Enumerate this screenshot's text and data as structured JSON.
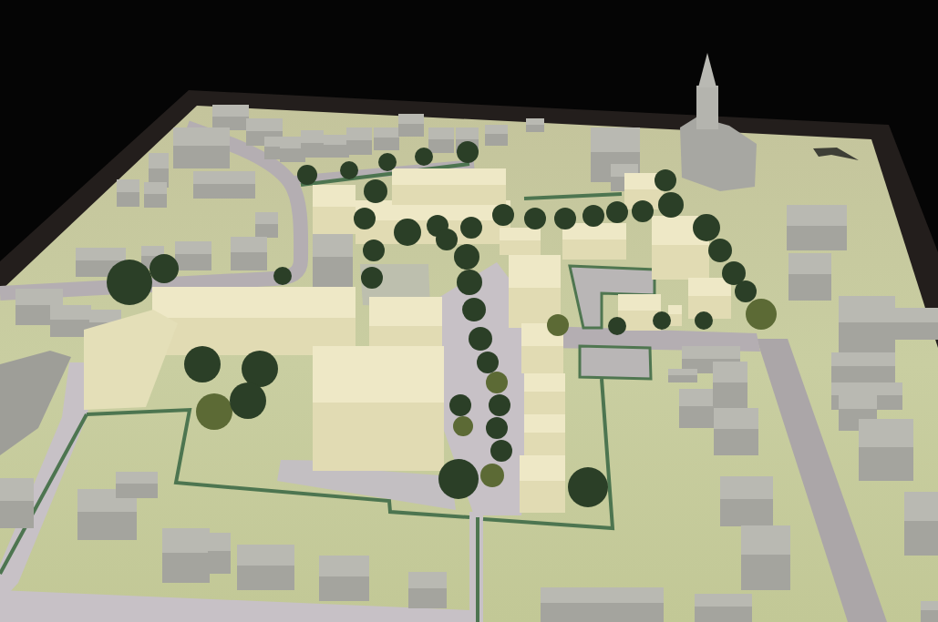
{
  "photo": {
    "kind": "scale-model"
  }
}
